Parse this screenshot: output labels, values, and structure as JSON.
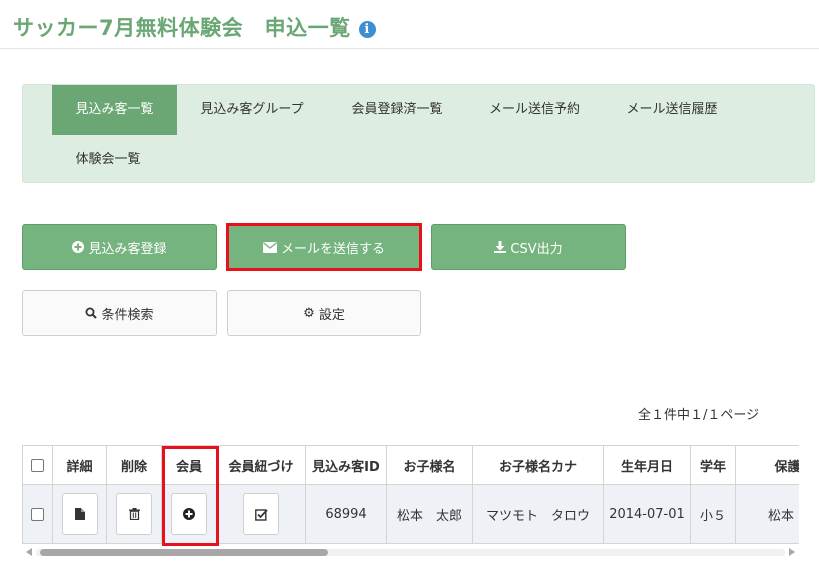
{
  "page": {
    "title": "サッカー7月無料体験会　申込一覧"
  },
  "nav": {
    "tabs": [
      {
        "label": "見込み客一覧",
        "active": true
      },
      {
        "label": "見込み客グループ",
        "active": false
      },
      {
        "label": "会員登録済一覧",
        "active": false
      },
      {
        "label": "メール送信予約",
        "active": false
      },
      {
        "label": "メール送信履歴",
        "active": false
      },
      {
        "label": "体験会一覧",
        "active": false
      }
    ]
  },
  "actions": {
    "register": "見込み客登録",
    "send_mail": "メールを送信する",
    "csv": "CSV出力",
    "search": "条件検索",
    "settings": "設定"
  },
  "pagination": {
    "text": "全１件中１/１ページ"
  },
  "table": {
    "headers": [
      "詳細",
      "削除",
      "会員",
      "会員紐づけ",
      "見込み客ID",
      "お子様名",
      "お子様名カナ",
      "生年月日",
      "学年",
      "保護者"
    ],
    "rows": [
      {
        "id": "68994",
        "child_name": "松本　太郎",
        "child_kana": "マツモト　タロウ",
        "birthdate": "2014-07-01",
        "grade": "小５",
        "guardian": "松本　保"
      }
    ]
  },
  "colors": {
    "accent": "#6aa775",
    "button_green": "#75b47e",
    "nav_bg": "#ddede2",
    "highlight": "#e8101a",
    "info": "#3d8fd1"
  },
  "icons": [
    "info-icon",
    "plus-circle-icon",
    "envelope-icon",
    "download-icon",
    "search-icon",
    "gear-icon",
    "file-icon",
    "trash-icon",
    "check-square-icon"
  ]
}
